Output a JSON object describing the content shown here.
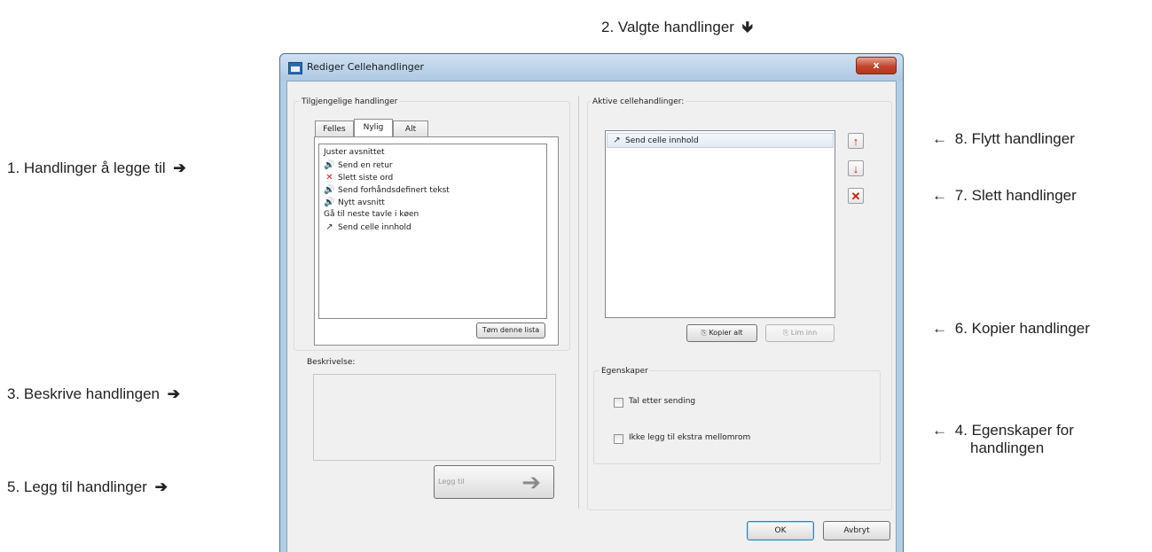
{
  "callouts": {
    "c2": "2. Valgte handlinger",
    "c1": "1. Handlinger å legge til",
    "c3": "3. Beskrive handlingen",
    "c5": "5. Legg til handlinger",
    "c8": "8. Flytt handlinger",
    "c7": "7. Slett handlinger",
    "c6": "6. Kopier handlinger",
    "c4_line1": "4. Egenskaper for",
    "c4_line2": "handlingen"
  },
  "dialog": {
    "title": "Rediger Cellehandlinger",
    "close_label": "x",
    "available_group": "Tilgjengelige handlinger",
    "tabs": [
      "Felles",
      "Nylig",
      "Alt"
    ],
    "active_tab": "Nylig",
    "available_items": [
      {
        "label": "Juster avsnittet",
        "icon": ""
      },
      {
        "label": "Send en retur",
        "icon": "speaker-icon"
      },
      {
        "label": "Slett siste ord",
        "icon": "red-x-icon"
      },
      {
        "label": "Send forhåndsdefinert tekst",
        "icon": "speaker-icon"
      },
      {
        "label": "Nytt avsnitt",
        "icon": "speaker-icon"
      },
      {
        "label": "Gå til neste tavle i køen",
        "icon": ""
      },
      {
        "label": "Send celle innhold",
        "icon": "arrow-icon"
      }
    ],
    "clear_list_button": "Tøm denne lista",
    "description_label": "Beskrivelse:",
    "add_button": "Legg til",
    "active_group": "Aktive cellehandlinger:",
    "active_items": [
      {
        "label": "Send celle innhold",
        "icon": "arrow-icon"
      }
    ],
    "copy_all_button": "Kopier alt",
    "paste_button": "Lim inn",
    "properties_group": "Egenskaper",
    "checkbox_speak": "Tal etter sending",
    "checkbox_nospace": "Ikke legg til ekstra mellomrom",
    "ok_button": "OK",
    "cancel_button": "Avbryt",
    "accent_red": "#d11a0e"
  }
}
